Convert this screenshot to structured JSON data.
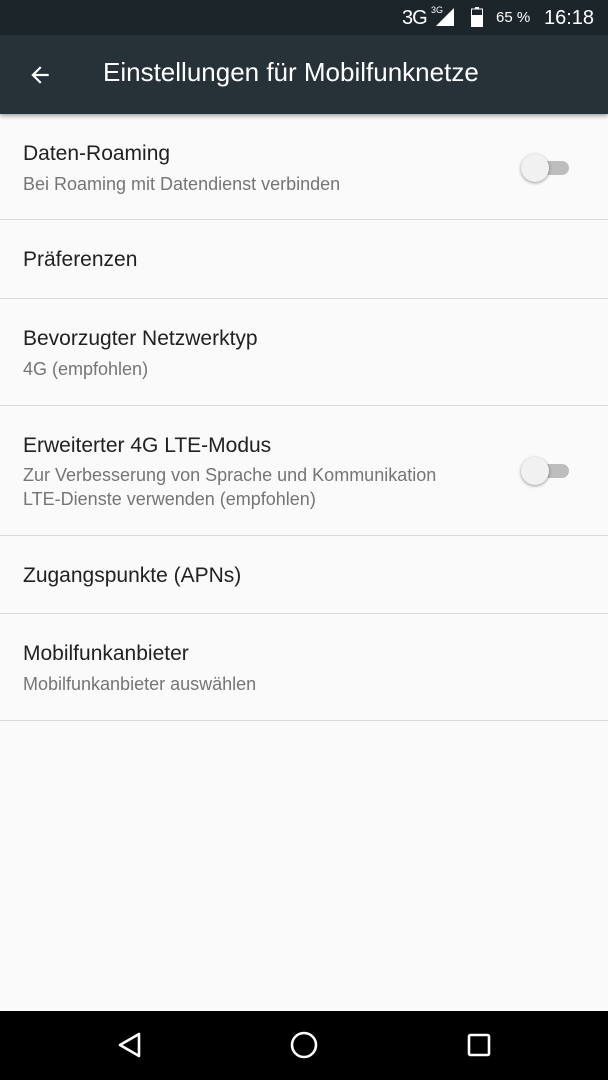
{
  "status_bar": {
    "network": "3G",
    "network_small": "3G",
    "battery": "65 %",
    "time": "16:18"
  },
  "app_bar": {
    "title": "Einstellungen für Mobilfunknetze",
    "back_icon": "arrow-back-icon"
  },
  "settings": {
    "data_roaming": {
      "title": "Daten-Roaming",
      "summary": "Bei Roaming mit Datendienst verbinden",
      "enabled": false
    },
    "preferences": {
      "title": "Präferenzen"
    },
    "network_type": {
      "title": "Bevorzugter Netzwerktyp",
      "summary": "4G (empfohlen)"
    },
    "lte_mode": {
      "title": "Erweiterter 4G LTE-Modus",
      "summary_line1": "Zur Verbesserung von Sprache und Kommunikation",
      "summary_line2": "LTE-Dienste verwenden (empfohlen)",
      "enabled": false
    },
    "apn": {
      "title": "Zugangspunkte (APNs)"
    },
    "carrier": {
      "title": "Mobilfunkanbieter",
      "summary": "Mobilfunkanbieter auswählen"
    }
  },
  "nav_bar": {
    "back_icon": "nav-back-icon",
    "home_icon": "home-icon",
    "recents_icon": "recents-icon"
  },
  "colors": {
    "status_bar": "#1c262a",
    "app_bar": "#263238",
    "background": "#fafafa",
    "title_text": "#212121",
    "summary_text": "#757575"
  }
}
